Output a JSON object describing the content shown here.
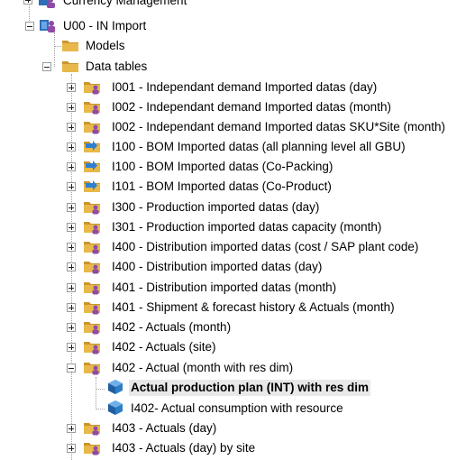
{
  "tree": {
    "items": [
      {
        "label": "Currency Management",
        "icon": "model-group-icon",
        "expander": "plus"
      },
      {
        "label": "U00 - IN Import",
        "icon": "model-group-icon",
        "expander": "minus"
      },
      {
        "label": "Models",
        "icon": "folder-icon",
        "expander": "none"
      },
      {
        "label": "Data tables",
        "icon": "folder-icon",
        "expander": "minus"
      },
      {
        "label": "I001 - Independant demand Imported datas (day)",
        "icon": "folder-users-icon",
        "expander": "plus"
      },
      {
        "label": "I002 - Independant demand Imported datas (month)",
        "icon": "folder-users-icon",
        "expander": "plus"
      },
      {
        "label": "I002 - Independant demand Imported datas SKU*Site (month)",
        "icon": "folder-users-icon",
        "expander": "plus"
      },
      {
        "label": "I100 - BOM Imported datas (all planning level  all GBU)",
        "icon": "folder-arrow-icon",
        "expander": "plus"
      },
      {
        "label": "I100 - BOM Imported datas (Co-Packing)",
        "icon": "folder-arrow-icon",
        "expander": "plus"
      },
      {
        "label": "I101 - BOM Imported datas (Co-Product)",
        "icon": "folder-arrow-icon",
        "expander": "plus"
      },
      {
        "label": "I300 - Production imported datas (day)",
        "icon": "folder-users-icon",
        "expander": "plus"
      },
      {
        "label": "I301 - Production imported datas capacity (month)",
        "icon": "folder-users-icon",
        "expander": "plus"
      },
      {
        "label": "I400 - Distribution imported datas (cost / SAP plant code)",
        "icon": "folder-users-icon",
        "expander": "plus"
      },
      {
        "label": "I400 - Distribution imported datas (day)",
        "icon": "folder-users-icon",
        "expander": "plus"
      },
      {
        "label": "I401 - Distribution imported datas (month)",
        "icon": "folder-users-icon",
        "expander": "plus"
      },
      {
        "label": "I401 - Shipment & forecast history & Actuals (month)",
        "icon": "folder-users-icon",
        "expander": "plus"
      },
      {
        "label": "I402 -  Actuals (month)",
        "icon": "folder-users-icon",
        "expander": "plus"
      },
      {
        "label": "I402 -  Actuals (site)",
        "icon": "folder-users-icon",
        "expander": "plus"
      },
      {
        "label": "I402 - Actual (month with res dim)",
        "icon": "folder-users-icon",
        "expander": "minus"
      },
      {
        "label": "Actual production plan (INT) with res dim",
        "icon": "cube-icon",
        "expander": "none",
        "selected": true
      },
      {
        "label": "I402- Actual consumption with resource",
        "icon": "cube-icon",
        "expander": "none"
      },
      {
        "label": "I403 -  Actuals (day)",
        "icon": "folder-users-icon",
        "expander": "plus"
      },
      {
        "label": "I403 -  Actuals (day) by site",
        "icon": "folder-users-icon",
        "expander": "plus"
      }
    ]
  },
  "colors": {
    "folder": "#e8b84a",
    "folder_dark": "#c9952c",
    "users": "#8e4aa6",
    "arrow": "#2f7fd0",
    "cube": "#2d7dc6",
    "selection": "#e8e8e8"
  }
}
